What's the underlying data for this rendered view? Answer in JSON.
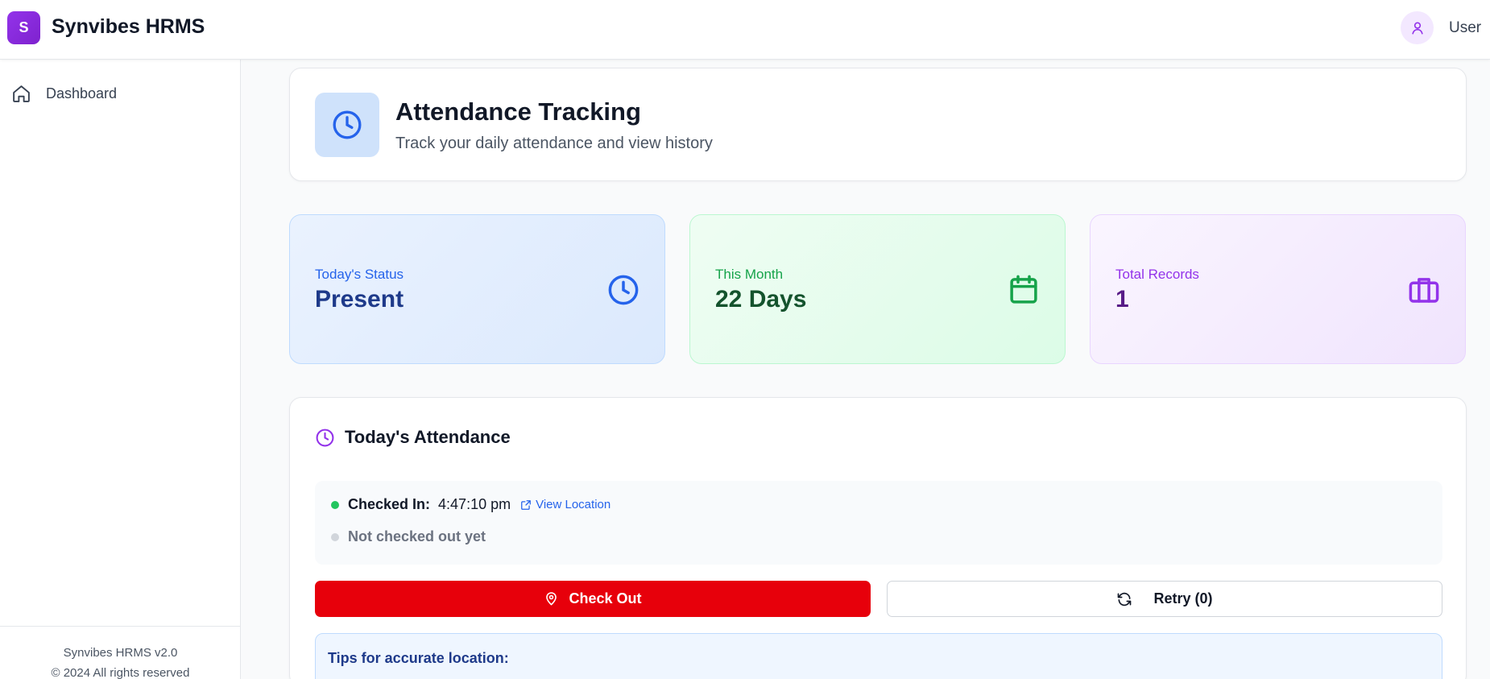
{
  "header": {
    "logo_letter": "S",
    "app_title": "Synvibes HRMS",
    "user_label": "User"
  },
  "sidebar": {
    "items": [
      {
        "label": "Dashboard",
        "icon": "home-icon"
      }
    ],
    "footer_version": "Synvibes HRMS v2.0",
    "footer_copyright": "© 2024 All rights reserved"
  },
  "page": {
    "title": "Attendance Tracking",
    "subtitle": "Track your daily attendance and view history"
  },
  "stats": [
    {
      "label": "Today's Status",
      "value": "Present",
      "icon": "clock-icon",
      "accent": "#2563eb"
    },
    {
      "label": "This Month",
      "value": "22 Days",
      "icon": "calendar-icon",
      "accent": "#16a34a"
    },
    {
      "label": "Total Records",
      "value": "1",
      "icon": "briefcase-icon",
      "accent": "#9333ea"
    }
  ],
  "attendance": {
    "title": "Today's Attendance",
    "checked_in_label": "Checked In:",
    "checked_in_time": "4:47:10 pm",
    "view_location": "View Location",
    "checkout_status": "Not checked out yet",
    "check_out_button": "Check Out",
    "retry_button": "Retry (0)",
    "tips_title": "Tips for accurate location:"
  },
  "colors": {
    "brand": "#9333ea",
    "danger": "#e7000b",
    "success_dot": "#22c55e",
    "link": "#2563eb"
  }
}
